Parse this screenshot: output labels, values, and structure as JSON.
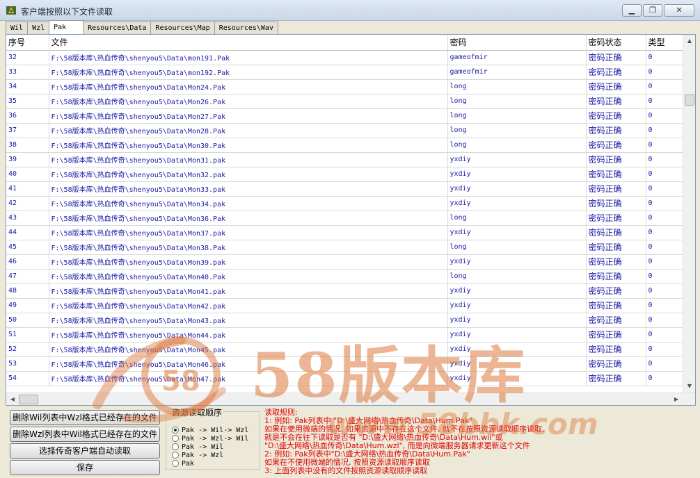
{
  "window": {
    "title": "客户端按照以下文件读取"
  },
  "tabs": [
    {
      "label": "Wil"
    },
    {
      "label": "Wzl"
    },
    {
      "label": "Pak"
    },
    {
      "label": "Resources\\Data"
    },
    {
      "label": "Resources\\Map"
    },
    {
      "label": "Resources\\Wav"
    }
  ],
  "table": {
    "columns": [
      "序号",
      "文件",
      "密码",
      "密码状态",
      "类型"
    ],
    "rows": [
      [
        "32",
        "F:\\58版本库\\热血传奇\\shenyou5\\Data\\mon191.Pak",
        "gameofmir",
        "密码正确",
        "0"
      ],
      [
        "33",
        "F:\\58版本库\\热血传奇\\shenyou5\\Data\\mon192.Pak",
        "gameofmir",
        "密码正确",
        "0"
      ],
      [
        "34",
        "F:\\58版本库\\热血传奇\\shenyou5\\Data\\Mon24.Pak",
        "long",
        "密码正确",
        "0"
      ],
      [
        "35",
        "F:\\58版本库\\热血传奇\\shenyou5\\Data\\Mon26.Pak",
        "long",
        "密码正确",
        "0"
      ],
      [
        "36",
        "F:\\58版本库\\热血传奇\\shenyou5\\Data\\Mon27.Pak",
        "long",
        "密码正确",
        "0"
      ],
      [
        "37",
        "F:\\58版本库\\热血传奇\\shenyou5\\Data\\Mon28.Pak",
        "long",
        "密码正确",
        "0"
      ],
      [
        "38",
        "F:\\58版本库\\热血传奇\\shenyou5\\Data\\Mon30.Pak",
        "long",
        "密码正确",
        "0"
      ],
      [
        "39",
        "F:\\58版本库\\热血传奇\\shenyou5\\Data\\Mon31.pak",
        "yxdiy",
        "密码正确",
        "0"
      ],
      [
        "40",
        "F:\\58版本库\\热血传奇\\shenyou5\\Data\\Mon32.pak",
        "yxdiy",
        "密码正确",
        "0"
      ],
      [
        "41",
        "F:\\58版本库\\热血传奇\\shenyou5\\Data\\Mon33.pak",
        "yxdiy",
        "密码正确",
        "0"
      ],
      [
        "42",
        "F:\\58版本库\\热血传奇\\shenyou5\\Data\\Mon34.pak",
        "yxdiy",
        "密码正确",
        "0"
      ],
      [
        "43",
        "F:\\58版本库\\热血传奇\\shenyou5\\Data\\Mon36.Pak",
        "long",
        "密码正确",
        "0"
      ],
      [
        "44",
        "F:\\58版本库\\热血传奇\\shenyou5\\Data\\Mon37.pak",
        "yxdiy",
        "密码正确",
        "0"
      ],
      [
        "45",
        "F:\\58版本库\\热血传奇\\shenyou5\\Data\\Mon38.Pak",
        "long",
        "密码正确",
        "0"
      ],
      [
        "46",
        "F:\\58版本库\\热血传奇\\shenyou5\\Data\\Mon39.pak",
        "yxdiy",
        "密码正确",
        "0"
      ],
      [
        "47",
        "F:\\58版本库\\热血传奇\\shenyou5\\Data\\Mon40.Pak",
        "long",
        "密码正确",
        "0"
      ],
      [
        "48",
        "F:\\58版本库\\热血传奇\\shenyou5\\Data\\Mon41.pak",
        "yxdiy",
        "密码正确",
        "0"
      ],
      [
        "49",
        "F:\\58版本库\\热血传奇\\shenyou5\\Data\\Mon42.pak",
        "yxdiy",
        "密码正确",
        "0"
      ],
      [
        "50",
        "F:\\58版本库\\热血传奇\\shenyou5\\Data\\Mon43.pak",
        "yxdiy",
        "密码正确",
        "0"
      ],
      [
        "51",
        "F:\\58版本库\\热血传奇\\shenyou5\\Data\\Mon44.pak",
        "yxdiy",
        "密码正确",
        "0"
      ],
      [
        "52",
        "F:\\58版本库\\热血传奇\\shenyou5\\Data\\Mon45.pak",
        "yxdiy",
        "密码正确",
        "0"
      ],
      [
        "53",
        "F:\\58版本库\\热血传奇\\shenyou5\\Data\\Mon46.pak",
        "yxdiy",
        "密码正确",
        "0"
      ],
      [
        "54",
        "F:\\58版本库\\热血传奇\\shenyou5\\Data\\Mon47.pak",
        "yxdiy",
        "密码正确",
        "0"
      ]
    ]
  },
  "buttons": {
    "delete_wil": "删除Wil列表中Wzl格式已经存在的文件",
    "delete_wzl": "删除Wzl列表中Wil格式已经存在的文件",
    "auto_read": "选择传奇客户端自动读取",
    "save": "保存"
  },
  "order_group": {
    "title": "资源读取顺序",
    "options": [
      {
        "label": "Pak -> Wil-> Wzl",
        "selected": true
      },
      {
        "label": "Pak -> Wzl-> Wil",
        "selected": false
      },
      {
        "label": "Pak -> Wil",
        "selected": false
      },
      {
        "label": "Pak -> Wzl",
        "selected": false
      },
      {
        "label": "Pak",
        "selected": false
      }
    ]
  },
  "rules": {
    "title": "读取规则:",
    "lines": [
      "1: 例如: Pak列表中 \"D:\\盛大网络\\热血传奇\\Data\\Hum.Pak\"",
      "   如果在使用微端的情况, 如果资源中不存在这个文件, 就不在按照资源读取顺序读取,",
      "   就是不会在往下读取是否有 \"D:\\盛大网络\\热血传奇\\Data\\Hum.wil\"或",
      "   \"D:\\盛大网络\\热血传奇\\Data\\Hum.wzl\", 而是向微端服务器请求更新这个文件",
      "2: 例如: Pak列表中\"D:\\盛大网络\\热血传奇\\Data\\Hum.Pak\"",
      "   如果在不使用微端的情况, 按照资源读取顺序读取",
      "3: 上面列表中没有的文件按照资源读取顺序读取"
    ]
  },
  "watermark": {
    "brand": "58版本库",
    "url": "www.58bbk.com",
    "badge": "58"
  },
  "colors": {
    "row_text": "#1a1aa6",
    "rules_text": "#e00000",
    "watermark": "#dc783c"
  },
  "icons": [
    "app-icon",
    "minimize-icon",
    "restore-icon",
    "close-icon",
    "scroll-up-arrow-icon",
    "scroll-down-arrow-icon",
    "scroll-left-arrow-icon",
    "scroll-right-arrow-icon"
  ]
}
